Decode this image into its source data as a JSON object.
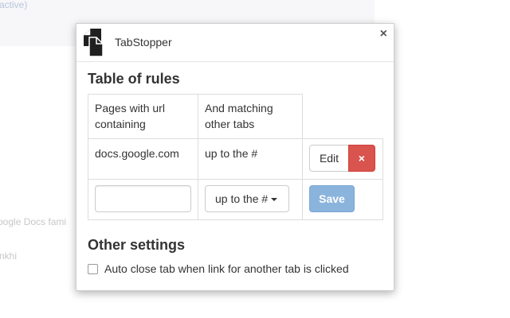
{
  "background": {
    "text_active": "active)",
    "text_docs": "oogle Docs fami",
    "text_khi": "nkhi"
  },
  "dialog": {
    "title": "TabStopper",
    "close_icon": "close-icon",
    "app_icon": "documents-icon"
  },
  "rules": {
    "heading": "Table of rules",
    "columns": [
      "Pages with url containing",
      "And matching other tabs"
    ],
    "rows": [
      {
        "url": "docs.google.com",
        "match": "up to the #",
        "edit_label": "Edit",
        "delete_label": "×"
      }
    ],
    "new_rule": {
      "url_value": "",
      "match_selected": "up to the #",
      "save_label": "Save"
    }
  },
  "settings": {
    "heading": "Other settings",
    "auto_close_label": "Auto close tab when link for another tab is clicked",
    "auto_close_checked": false
  },
  "colors": {
    "delete_button": "#d9534f",
    "save_button": "#8bb4dd",
    "border": "#dddddd"
  }
}
